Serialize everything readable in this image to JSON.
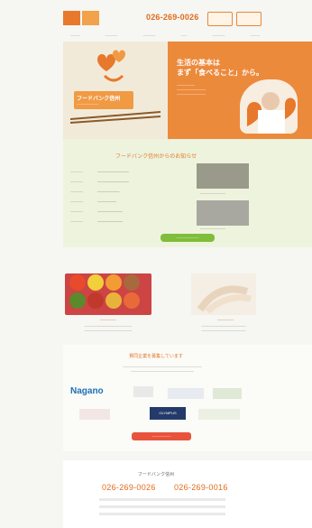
{
  "header": {
    "phone": "026-269-0026"
  },
  "hero": {
    "headline": "生活の基本は",
    "subhead": "まず「食べること」から。",
    "sign_title": "フードバンク信州"
  },
  "news": {
    "title": "フードバンク信州からのお知らせ"
  },
  "supporters": {
    "title": "賛同企業を募集しています",
    "logos": [
      "Nagano",
      "OLYMPUS"
    ]
  },
  "footer": {
    "name": "フードバンク信州",
    "phone": "026-269-0026",
    "fax": "026-269-0016"
  },
  "colors": {
    "accent": "#e8782c",
    "news_bg": "#eef3dd",
    "button_green": "#7fbd3a",
    "button_red": "#e8533b"
  }
}
